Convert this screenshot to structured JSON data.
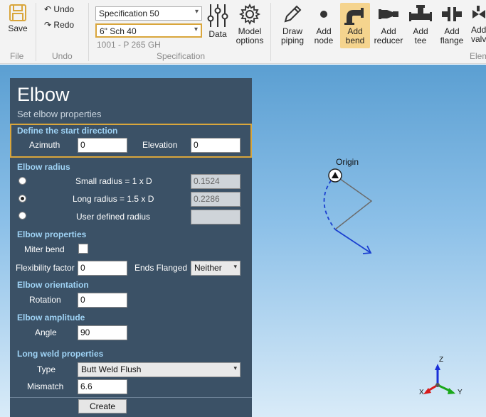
{
  "ribbon": {
    "save": "Save",
    "undo": "Undo",
    "redo": "Redo",
    "spec_select": "Specification 50",
    "size_select": "6\" Sch 40",
    "material": "1001 - P 265 GH",
    "data": "Data",
    "model_options_1": "Model",
    "model_options_2": "options",
    "draw_piping_1": "Draw",
    "draw_piping_2": "piping",
    "add_node_1": "Add",
    "add_node_2": "node",
    "add_bend_1": "Add",
    "add_bend_2": "bend",
    "add_reducer_1": "Add",
    "add_reducer_2": "reducer",
    "add_tee_1": "Add",
    "add_tee_2": "tee",
    "add_flange_1": "Add",
    "add_flange_2": "flange",
    "add_valve_1": "Add",
    "add_valve_2": "valv",
    "group_file": "File",
    "group_undo": "Undo",
    "group_spec": "Specification",
    "group_elements": "Elem"
  },
  "panel": {
    "title": "Elbow",
    "subtitle": "Set elbow properties",
    "start_direction": {
      "header": "Define the start direction",
      "azimuth_label": "Azimuth",
      "azimuth_value": "0",
      "elevation_label": "Elevation",
      "elevation_value": "0"
    },
    "radius": {
      "header": "Elbow radius",
      "small_label": "Small radius = 1 x D",
      "small_value": "0.1524",
      "long_label": "Long radius = 1.5 x D",
      "long_value": "0.2286",
      "user_label": "User defined radius",
      "user_value": ""
    },
    "properties": {
      "header": "Elbow properties",
      "miter_label": "Miter bend",
      "flex_label": "Flexibility factor",
      "flex_value": "0",
      "ends_label": "Ends Flanged",
      "ends_value": "Neither"
    },
    "orientation": {
      "header": "Elbow orientation",
      "rotation_label": "Rotation",
      "rotation_value": "0"
    },
    "amplitude": {
      "header": "Elbow amplitude",
      "angle_label": "Angle",
      "angle_value": "90"
    },
    "weld": {
      "header": "Long weld properties",
      "type_label": "Type",
      "type_value": "Butt Weld Flush",
      "mismatch_label": "Mismatch",
      "mismatch_value": "6.6"
    },
    "create": "Create"
  },
  "viewport": {
    "origin_label": "Origin",
    "axis_z": "Z",
    "axis_x": "X",
    "axis_y": "Y"
  },
  "colors": {
    "highlight": "#d9a63c",
    "panel_bg": "#3b5166",
    "section_header": "#9fd3f5",
    "active_button": "#f5d48e"
  }
}
